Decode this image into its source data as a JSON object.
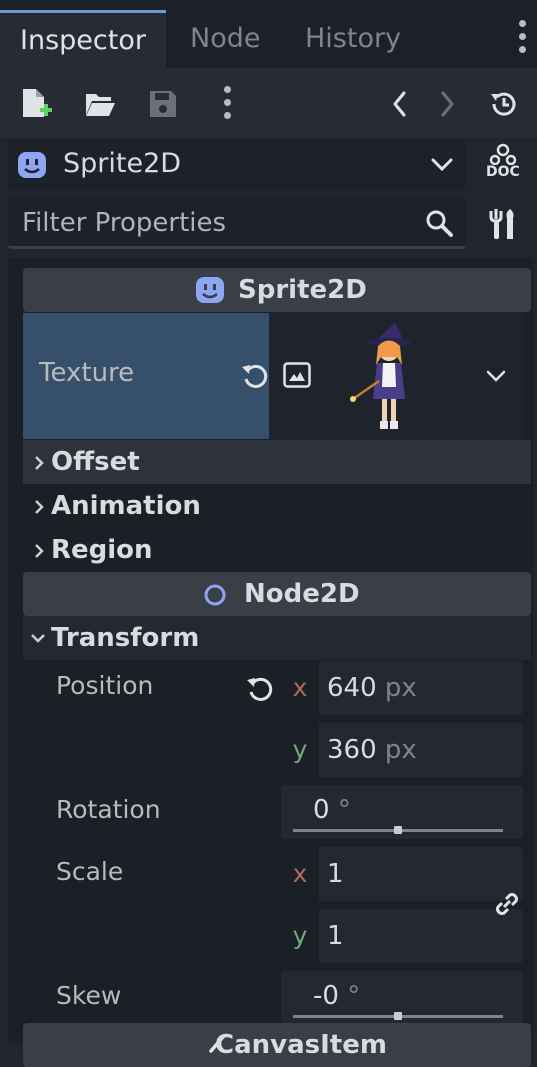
{
  "tabs": [
    {
      "label": "Inspector",
      "active": true
    },
    {
      "label": "Node",
      "active": false
    },
    {
      "label": "History",
      "active": false
    }
  ],
  "toolbar_icons": [
    "new-resource-icon",
    "open-folder-icon",
    "save-icon",
    "more-options-icon",
    "back-icon",
    "forward-icon",
    "history-icon"
  ],
  "node_selector": {
    "value": "Sprite2D",
    "doc_label": "DOC"
  },
  "filter": {
    "placeholder": "Filter Properties"
  },
  "sections": {
    "sprite2d": {
      "title": "Sprite2D"
    },
    "node2d": {
      "title": "Node2D"
    },
    "canvas_item": {
      "title": "CanvasItem"
    }
  },
  "texture": {
    "label": "Texture"
  },
  "groups": {
    "offset": "Offset",
    "animation": "Animation",
    "region": "Region",
    "transform": "Transform"
  },
  "transform": {
    "position": {
      "label": "Position",
      "x_axis": "x",
      "y_axis": "y",
      "x": "640",
      "y": "360",
      "unit": "px"
    },
    "rotation": {
      "label": "Rotation",
      "value": "0",
      "unit": "°",
      "slider_level": 0.5
    },
    "scale": {
      "label": "Scale",
      "x_axis": "x",
      "y_axis": "y",
      "x": "1",
      "y": "1"
    },
    "skew": {
      "label": "Skew",
      "value": "-0",
      "unit": "°",
      "slider_level": 0.5
    }
  },
  "colors": {
    "accent": "#6c9ad6",
    "x_axis": "#b4675e",
    "y_axis": "#6fa87a",
    "texture_bg": "#36506b",
    "node2d_icon": "#8da5f3"
  }
}
